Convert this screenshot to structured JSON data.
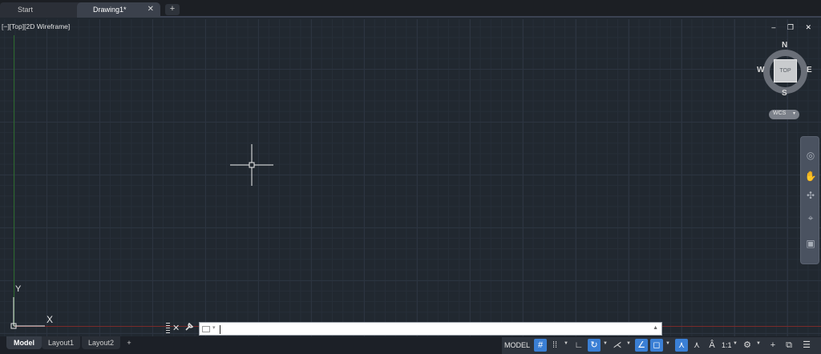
{
  "tabs": {
    "start": "Start",
    "drawing": "Drawing1*",
    "close_glyph": "✕",
    "add_glyph": "+"
  },
  "viewport": {
    "label": "[−][Top][2D Wireframe]",
    "window_controls": "‒ ❐ ✕"
  },
  "ucs": {
    "y": "Y",
    "x": "X"
  },
  "viewcube": {
    "n": "N",
    "s": "S",
    "e": "E",
    "w": "W",
    "face": "TOP",
    "wcs": "WCS",
    "wcs_caret": "▾"
  },
  "navbar": {
    "icons": [
      "steering-wheel-icon",
      "pan-icon",
      "zoom-icon",
      "orbit-icon",
      "showmotion-icon"
    ]
  },
  "command": {
    "close": "✕",
    "wrench": "🔧",
    "caret": "▾",
    "scroll": "▲"
  },
  "layout_tabs": {
    "model": "Model",
    "layout1": "Layout1",
    "layout2": "Layout2",
    "add": "+"
  },
  "status": {
    "model": "MODEL",
    "scale": "1:1",
    "icons": [
      "grid-icon",
      "snap-icon",
      "ortho-icon",
      "polar-icon",
      "isodraft-icon",
      "osnap-track-icon",
      "osnap-icon",
      "annotation-visibility-icon",
      "auto-scale-icon",
      "annotation-scale-icon",
      "workspace-gear-icon",
      "plus-icon",
      "isolate-icon",
      "customize-icon"
    ],
    "accent": "#3a7fd5"
  }
}
